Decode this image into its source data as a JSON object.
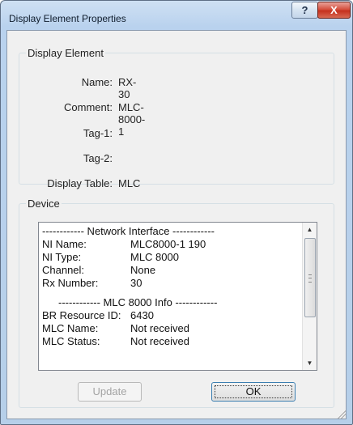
{
  "window": {
    "title": "Display Element Properties",
    "help_glyph": "?",
    "close_glyph": "X"
  },
  "display_element": {
    "legend": "Display Element",
    "fields": [
      {
        "label": "Name:",
        "value": "RX-30"
      },
      {
        "label": "Comment:",
        "value": "MLC-8000-1"
      },
      {
        "label": "Tag-1:",
        "value": ""
      },
      {
        "label": "Tag-2:",
        "value": ""
      },
      {
        "label": "Display Table:",
        "value": "MLC"
      }
    ]
  },
  "device": {
    "legend": "Device",
    "network_interface_header": "------------ Network Interface ------------",
    "network_interface": [
      {
        "key": "NI Name:",
        "value": "MLC8000-1 190"
      },
      {
        "key": "NI Type:",
        "value": "MLC 8000"
      },
      {
        "key": "Channel:",
        "value": "None"
      },
      {
        "key": "Rx Number:",
        "value": "30"
      }
    ],
    "mlc_info_header": "------------ MLC 8000 Info ------------",
    "mlc_info": [
      {
        "key": "BR Resource ID:",
        "value": "6430"
      },
      {
        "key": "MLC Name:",
        "value": "Not received"
      },
      {
        "key": "MLC Status:",
        "value": "Not received"
      }
    ],
    "scroll_up_glyph": "▲",
    "scroll_down_glyph": "▼"
  },
  "buttons": {
    "update": "Update",
    "ok": "OK"
  },
  "colors": {
    "title_bar": "#b9d2ee",
    "close_button": "#c5311e",
    "client_background": "#f0f0f0"
  }
}
